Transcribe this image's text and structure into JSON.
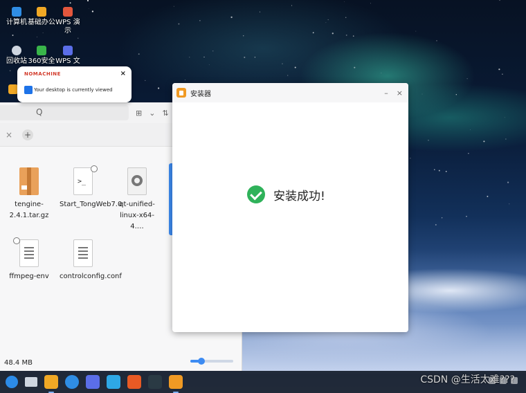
{
  "desktop": {
    "icons": [
      {
        "label": "计算机",
        "color": "#2f8de4"
      },
      {
        "label": "基础办公",
        "color": "#f0a825"
      },
      {
        "label": "WPS 演示",
        "color": "#e4573d"
      },
      {
        "label": "回收站",
        "color": "#cfd6e0"
      },
      {
        "label": "360安全",
        "color": "#39b54a"
      },
      {
        "label": "WPS 文",
        "color": "#5b6ee8"
      }
    ]
  },
  "notification": {
    "brand": "NOMACHINE",
    "message": "Your desktop is currently viewed",
    "close": "×"
  },
  "file_manager": {
    "search_icon": "Q",
    "tools": [
      "⊞",
      "⌄",
      "⇅",
      "⌄"
    ],
    "tab_close": "×",
    "tab_add": "+",
    "files": [
      {
        "name": "tengine-2.4.1.tar.gz",
        "icon": "archive-icon"
      },
      {
        "name": "Start_TongWeb7.0",
        "icon": "script-icon"
      },
      {
        "name": "qt-unified-linux-x64-4.…",
        "icon": "executable-icon"
      },
      {
        "name": "ffmpeg-env",
        "icon": "document-icon"
      },
      {
        "name": "controlconfig.conf",
        "icon": "document-icon"
      }
    ],
    "status": "48.4 MB",
    "zoom_fraction": 0.25
  },
  "installer": {
    "title": "安装器",
    "minimize": "–",
    "close": "×",
    "message": "安装成功!"
  },
  "taskbar": {
    "apps": [
      {
        "name": "start-icon",
        "color": "#2c8be8"
      },
      {
        "name": "show-desktop-icon",
        "color": "#cfd6e0"
      },
      {
        "name": "file-manager-icon",
        "color": "#f0a825"
      },
      {
        "name": "browser-icon",
        "color": "#2f8de4"
      },
      {
        "name": "wps-writer-icon",
        "color": "#5b6ee8"
      },
      {
        "name": "software-center-icon",
        "color": "#2ea8e6"
      },
      {
        "name": "nomachine-icon",
        "color": "#e85a24"
      },
      {
        "name": "terminal-icon",
        "color": "#2a3a44"
      },
      {
        "name": "installer-icon",
        "color": "#f09a24"
      }
    ],
    "watermark": "CSDN @生活太难???"
  }
}
